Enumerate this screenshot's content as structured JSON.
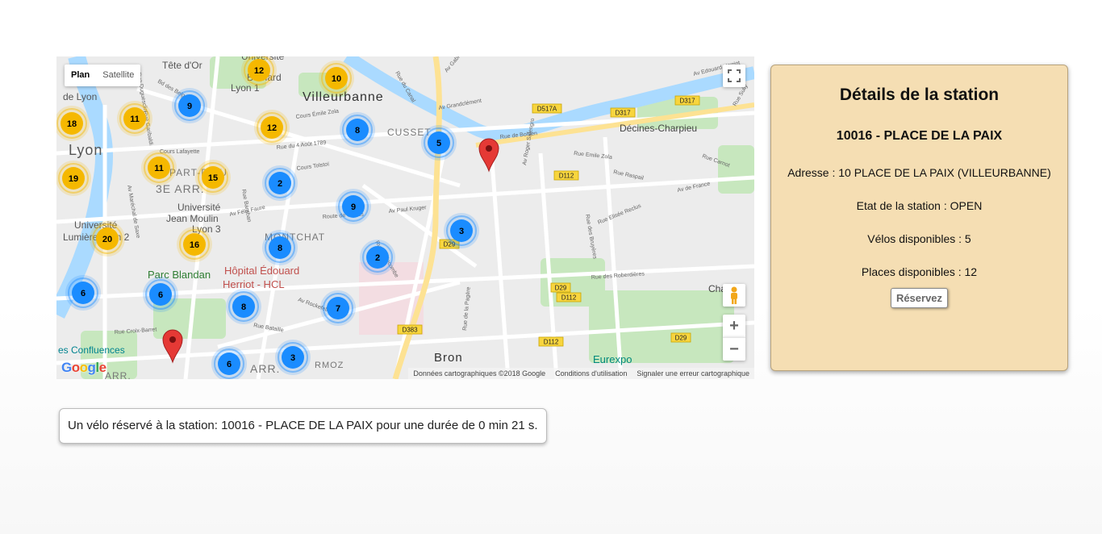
{
  "map": {
    "maptype": {
      "plan": "Plan",
      "satellite": "Satellite"
    },
    "place_labels": [
      "Villeurbanne",
      "Lyon",
      "CUSSET",
      "Décines-Charpieu",
      "3E ARR.",
      "MONTCHAT",
      "Hôpital Édouard",
      "Herriot - HCL",
      "Parc Blandan",
      "Université",
      "Jean Moulin",
      "Lyon 3",
      "Université",
      "Lumière Lyon 2",
      "Bron",
      "Eurexpo",
      "es Confluences",
      "Cha",
      "ARR.",
      "Université",
      "Bernard",
      "Lyon 1",
      "Tête d'Or",
      "de Lyon",
      "ARR.",
      "RMOZ",
      "PART-DIEU"
    ],
    "road_labels": [
      "Av Grandclément",
      "Cours Émile Zola",
      "Rue du 4 Août 1789",
      "Cours Tolstoï",
      "Av Félix Faure",
      "Route de Genas",
      "Av Paul Kruger",
      "Rue Emile Zola",
      "Rue Raspail",
      "Av de France",
      "Rue Elisée Reclus",
      "Av Roger Salengro",
      "Rue des Bruyères",
      "Rue des Roberdières",
      "Av Rockefeller",
      "Rue Bataille",
      "Rue Croix-Barret",
      "Cours Lafayette",
      "Av Maréchal de Saxe",
      "Rue de la Pagère",
      "Rue de Bohlen",
      "Av Edouard Herriot",
      "Rue du Canal",
      "Rue Garibaldi",
      "Bd des Belges",
      "Av Gabriel Péri",
      "Rue Sully",
      "Rue Carnot",
      "Rue Baraban",
      "Rue Duguesclin",
      "Rue Bellecombe"
    ],
    "road_badges": [
      "D517A",
      "D317",
      "D317",
      "D112",
      "D29",
      "D29",
      "D112",
      "D383",
      "D112",
      "D29"
    ],
    "clusters": [
      {
        "label": "12",
        "color": "yellow"
      },
      {
        "label": "10",
        "color": "yellow"
      },
      {
        "label": "9",
        "color": "blue"
      },
      {
        "label": "18",
        "color": "yellow"
      },
      {
        "label": "11",
        "color": "yellow"
      },
      {
        "label": "12",
        "color": "yellow"
      },
      {
        "label": "8",
        "color": "blue"
      },
      {
        "label": "5",
        "color": "blue"
      },
      {
        "label": "11",
        "color": "yellow"
      },
      {
        "label": "15",
        "color": "yellow"
      },
      {
        "label": "19",
        "color": "yellow"
      },
      {
        "label": "2",
        "color": "blue"
      },
      {
        "label": "9",
        "color": "blue"
      },
      {
        "label": "20",
        "color": "yellow"
      },
      {
        "label": "16",
        "color": "yellow"
      },
      {
        "label": "8",
        "color": "blue"
      },
      {
        "label": "3",
        "color": "blue"
      },
      {
        "label": "2",
        "color": "blue"
      },
      {
        "label": "6",
        "color": "blue"
      },
      {
        "label": "6",
        "color": "blue"
      },
      {
        "label": "8",
        "color": "blue"
      },
      {
        "label": "7",
        "color": "blue"
      },
      {
        "label": "3",
        "color": "blue"
      },
      {
        "label": "6",
        "color": "blue"
      }
    ],
    "attribution": {
      "data": "Données cartographiques ©2018 Google",
      "terms": "Conditions d'utilisation",
      "report": "Signaler une erreur cartographique"
    },
    "logo": "Google",
    "colors": {
      "cluster_yellow": "#f5b800",
      "cluster_blue": "#1a8cff",
      "marker": "#e53935",
      "water": "#aadaff",
      "park": "#c7e7be",
      "road_major": "#fde293"
    }
  },
  "panel": {
    "title": "Détails de la station",
    "station_name": "10016 - PLACE DE LA PAIX",
    "address": "Adresse : 10 PLACE DE LA PAIX (VILLEURBANNE)",
    "status": "Etat de la station : OPEN",
    "bikes": "Vélos disponibles : 5",
    "stands": "Places disponibles : 12",
    "reserve_button": "Réservez",
    "background_color": "#f5deb3"
  },
  "reservation_message": "Un vélo réservé à la station: 10016 - PLACE DE LA PAIX pour une durée de 0 min 21 s."
}
